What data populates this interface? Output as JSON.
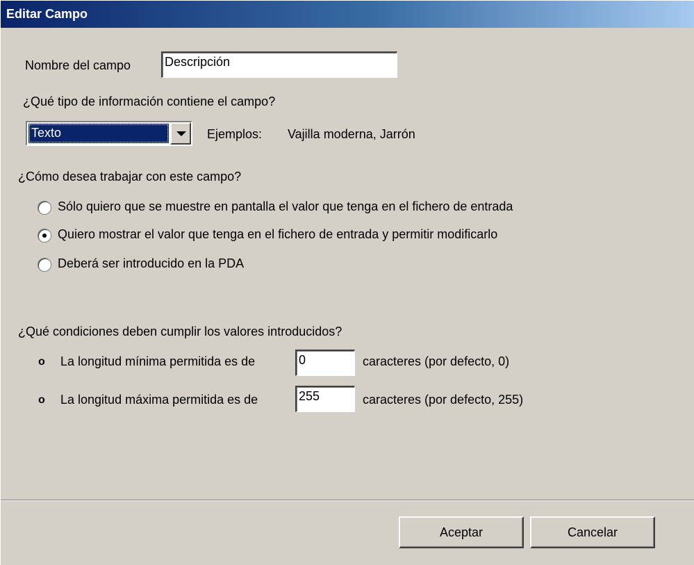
{
  "window": {
    "title": "Editar Campo"
  },
  "field_name": {
    "label": "Nombre  del campo",
    "value": "Descripción"
  },
  "info_type": {
    "question": "¿Qué tipo de información contiene el campo?",
    "selected": "Texto",
    "examples_label": "Ejemplos:",
    "examples_value": "Vajilla moderna, Jarrón"
  },
  "work_mode": {
    "question": "¿Cómo desea trabajar con este campo?",
    "options": [
      {
        "label": "Sólo quiero que se muestre en pantalla el valor que tenga en el fichero de entrada",
        "selected": false
      },
      {
        "label": "Quiero mostrar el valor que tenga en el fichero de entrada y permitir modificarlo",
        "selected": true
      },
      {
        "label": "Deberá ser introducido en la PDA",
        "selected": false
      }
    ]
  },
  "conditions": {
    "question": "¿Qué condiciones deben cumplir los valores introducidos?",
    "bullet": "o",
    "min_label": "La longitud mínima permitida es de",
    "min_value": "0",
    "min_suffix": "caracteres (por defecto, 0)",
    "max_label": "La longitud máxima permitida es de",
    "max_value": "255",
    "max_suffix": "caracteres (por defecto, 255)"
  },
  "buttons": {
    "accept": "Aceptar",
    "cancel": "Cancelar"
  },
  "colors": {
    "titlebar_start": "#0a246a",
    "titlebar_end": "#a6caf0",
    "face": "#d4d0c8",
    "selection": "#0a246a"
  }
}
